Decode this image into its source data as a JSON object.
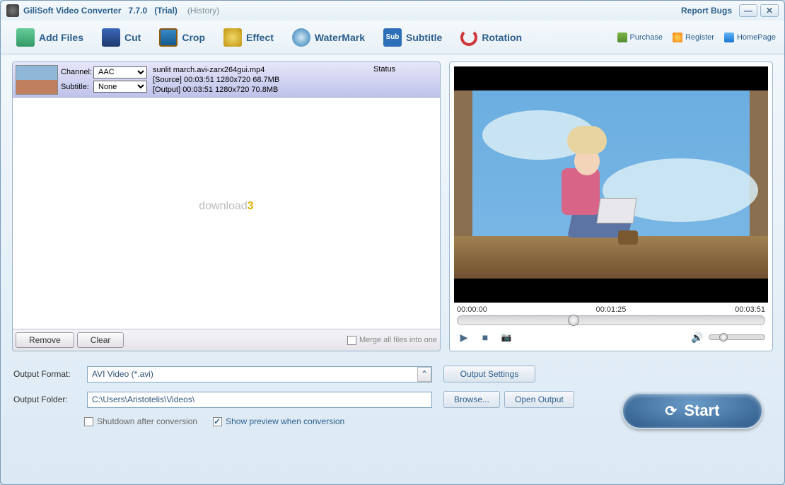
{
  "title": {
    "app": "GiliSoft Video Converter",
    "version": "7.7.0",
    "trial": "(Trial)",
    "history": "(History)",
    "report_bugs": "Report Bugs"
  },
  "toolbar": {
    "add_files": "Add Files",
    "cut": "Cut",
    "crop": "Crop",
    "effect": "Effect",
    "watermark": "WaterMark",
    "subtitle": "Subtitle",
    "subtitle_icon_text": "Sub",
    "rotation": "Rotation"
  },
  "links": {
    "purchase": "Purchase",
    "register": "Register",
    "homepage": "HomePage"
  },
  "file": {
    "channel_label": "Channel:",
    "channel_value": "AAC",
    "subtitle_label": "Subtitle:",
    "subtitle_value": "None",
    "filename": "sunlit march.avi-zarx264gui.mp4",
    "source_line": "[Source] 00:03:51 1280x720 68.7MB",
    "output_line": "[Output] 00:03:51 1280x720 70.8MB",
    "status_header": "Status"
  },
  "panel_footer": {
    "remove": "Remove",
    "clear": "Clear",
    "merge": "Merge all files into one"
  },
  "preview": {
    "time_start": "00:00:00",
    "time_current": "00:01:25",
    "time_end": "00:03:51"
  },
  "output": {
    "format_label": "Output Format:",
    "format_value": "AVI Video (*.avi)",
    "folder_label": "Output Folder:",
    "folder_value": "C:\\Users\\Aristotelis\\Videos\\",
    "settings_btn": "Output Settings",
    "browse_btn": "Browse...",
    "open_output_btn": "Open Output"
  },
  "checks": {
    "shutdown": "Shutdown after conversion",
    "show_preview": "Show preview when conversion"
  },
  "start_label": "Start",
  "watermark_download": "download",
  "watermark_3": "3"
}
